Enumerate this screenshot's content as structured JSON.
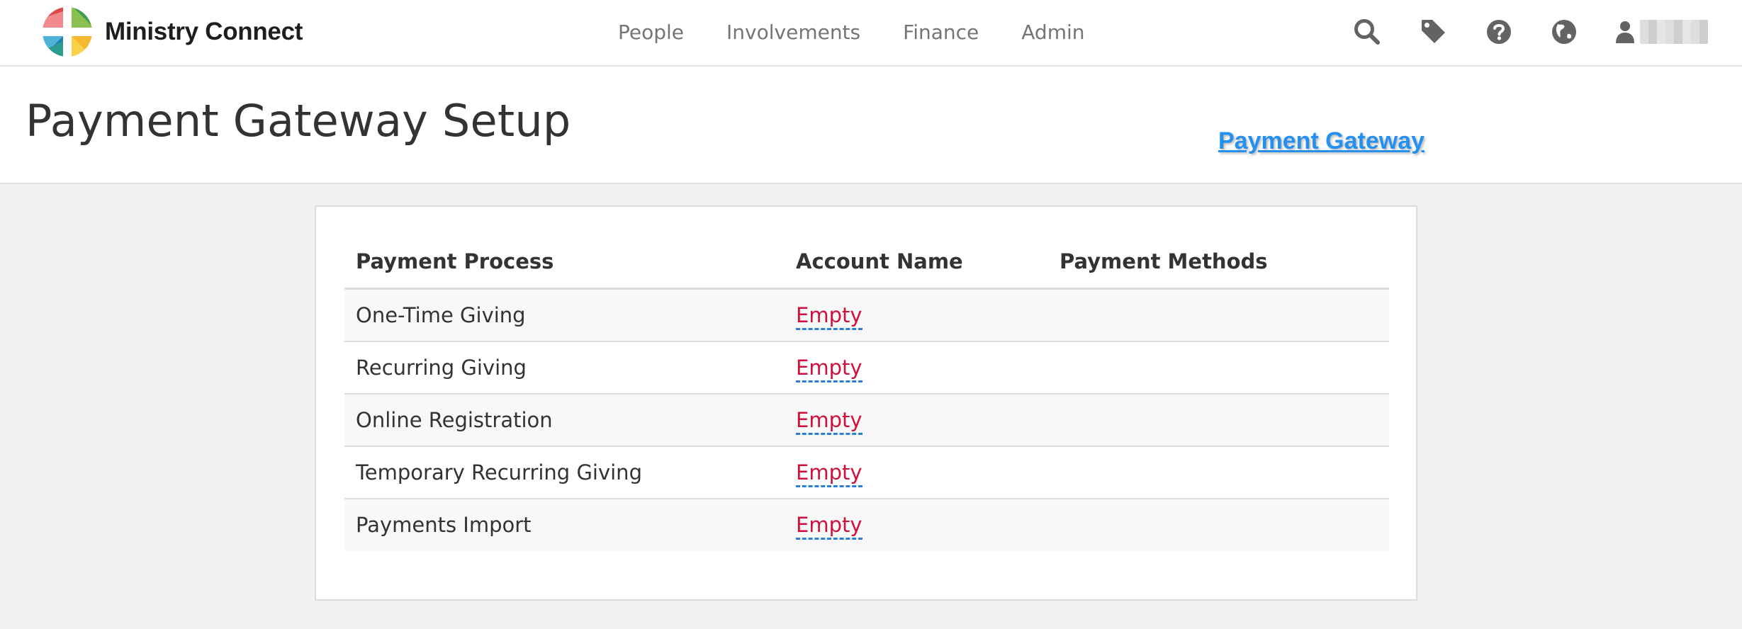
{
  "brand": {
    "name": "Ministry Connect",
    "logo_icon": "ministry-connect-logo-icon",
    "logo_colors": [
      "#e04b4b",
      "#3da35a",
      "#f3c12f",
      "#2a8fc1"
    ]
  },
  "nav": {
    "links": [
      "People",
      "Involvements",
      "Finance",
      "Admin"
    ],
    "icons": [
      "search-icon",
      "tag-icon",
      "help-icon",
      "globe-icon",
      "user-icon"
    ]
  },
  "header": {
    "title": "Payment Gateway Setup",
    "link_label": "Payment Gateway",
    "link_color": "#2590f0"
  },
  "table": {
    "columns": [
      "Payment Process",
      "Account Name",
      "Payment Methods"
    ],
    "rows": [
      {
        "process": "One-Time Giving",
        "account": "Empty",
        "methods": ""
      },
      {
        "process": "Recurring Giving",
        "account": "Empty",
        "methods": ""
      },
      {
        "process": "Online Registration",
        "account": "Empty",
        "methods": ""
      },
      {
        "process": "Temporary Recurring Giving",
        "account": "Empty",
        "methods": ""
      },
      {
        "process": "Payments Import",
        "account": "Empty",
        "methods": ""
      }
    ],
    "empty_color": "#d0103a"
  }
}
